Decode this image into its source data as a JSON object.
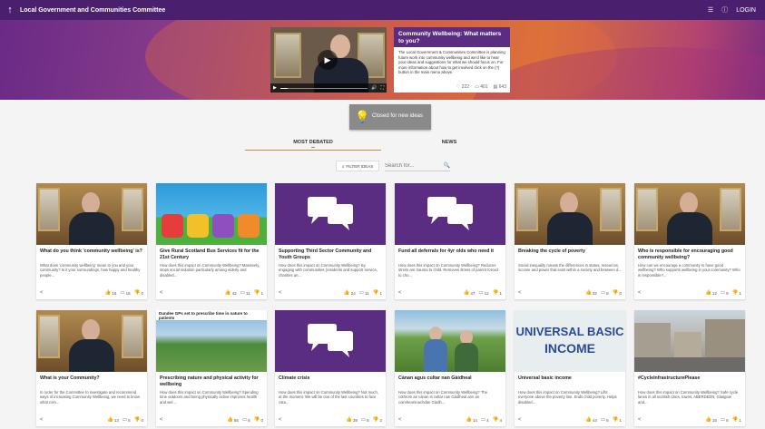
{
  "topbar": {
    "title": "Local Government and Communities Committee",
    "login": "LOGIN"
  },
  "hero": {
    "card_title": "Community Wellbeing: What matters to you?",
    "card_text": "The Local Government & Communities Committee is planning future work into community wellbeing and we'd like to hear your ideas and suggestions for what we should focus on. For more information about how to get involved click on the (?) button in the main menu above.",
    "likes": "222",
    "comments": "401",
    "ideas": "643"
  },
  "closed": "Closed for new ideas",
  "tabs": {
    "most_debated": "MOST DEBATED",
    "news": "NEWS"
  },
  "filter_label": "FILTER IDEAS",
  "search_placeholder": "Search for...",
  "cards": [
    {
      "title": "What do you think 'community wellbeing' is?",
      "desc": "What does 'community wellbeing' mean to you and your community? Is it your surroundings, how happy and healthy people...",
      "likes": "16",
      "comments": "15",
      "dislikes": "0"
    },
    {
      "title": "Give Rural Scotland Bus Services fit for the 21st Century",
      "desc": "How does this impact on Community Wellbeing? Massively, stops social isolation particularly among elderly and disabled...",
      "likes": "42",
      "comments": "11",
      "dislikes": "1"
    },
    {
      "title": "Supporting Third Sector Community and Youth Groups",
      "desc": "How does this impact on Community Wellbeing? By engaging with communities (residents and support service, charities an...",
      "likes": "24",
      "comments": "11",
      "dislikes": "1"
    },
    {
      "title": "Fund all deferrals for 4yr olds who need it",
      "desc": "How does this impact on Community Wellbeing? Reduces stress are trauma to child. Removes stress of parent forced to cho...",
      "likes": "47",
      "comments": "12",
      "dislikes": "1"
    },
    {
      "title": "Breaking the cycle of poverty",
      "desc": "Social inequality means the differences in status, resources, income and power that exist within a society and between d...",
      "likes": "32",
      "comments": "6",
      "dislikes": "0"
    },
    {
      "title": "Who is responsible for encouraging good community wellbeing?",
      "desc": "How can we encourage a community to have good wellbeing? Who supports wellbeing in your community? Who is responsible?...",
      "likes": "12",
      "comments": "9",
      "dislikes": "1"
    },
    {
      "title": "What is your Community?",
      "desc": "In order for the Committee to investigate and recommend ways of increasing Community Wellbeing, we need to know what com...",
      "likes": "13",
      "comments": "5",
      "dislikes": "0"
    },
    {
      "title": "Prescribing nature and physical activity for wellbeing",
      "desc": "How does this impact on Community Wellbeing? Spending time outdoors and being physically active improves health and wel...",
      "likes": "56",
      "comments": "6",
      "dislikes": "0"
    },
    {
      "title": "Climate crisis",
      "desc": "How does this impact on Community Wellbeing? Not much, at the moment. We will be one of the last countries to face cata...",
      "likes": "39",
      "comments": "8",
      "dislikes": "2"
    },
    {
      "title": "Cànan agus cultar nan Gàidheal",
      "desc": "How does this impact on Community Wellbeing? The cothrom air cànan is cultar nan Gàidheal ann an coimhearsnachdan Gàidh...",
      "likes": "14",
      "comments": "4",
      "dislikes": "4"
    },
    {
      "title": "Universal basic income",
      "desc": "How does this impact on Community Wellbeing? Lifts everyone above the poverty line. Ends child poverty. Helps disabled...",
      "likes": "44",
      "comments": "6",
      "dislikes": "1"
    },
    {
      "title": "#CycleInfrastructurePlease",
      "desc": "How does this impact on Community Wellbeing? Safe cycle lanes in all scottish cities, towns, ABERDEEN, Glasgow and...",
      "likes": "15",
      "comments": "6",
      "dislikes": "1"
    }
  ],
  "thumb_texts": {
    "nature_caption": "Dundee GPs set to prescribe time in nature to patients",
    "ubi_line1": "UNIVERSAL BASIC",
    "ubi_line2": "INCOME"
  }
}
